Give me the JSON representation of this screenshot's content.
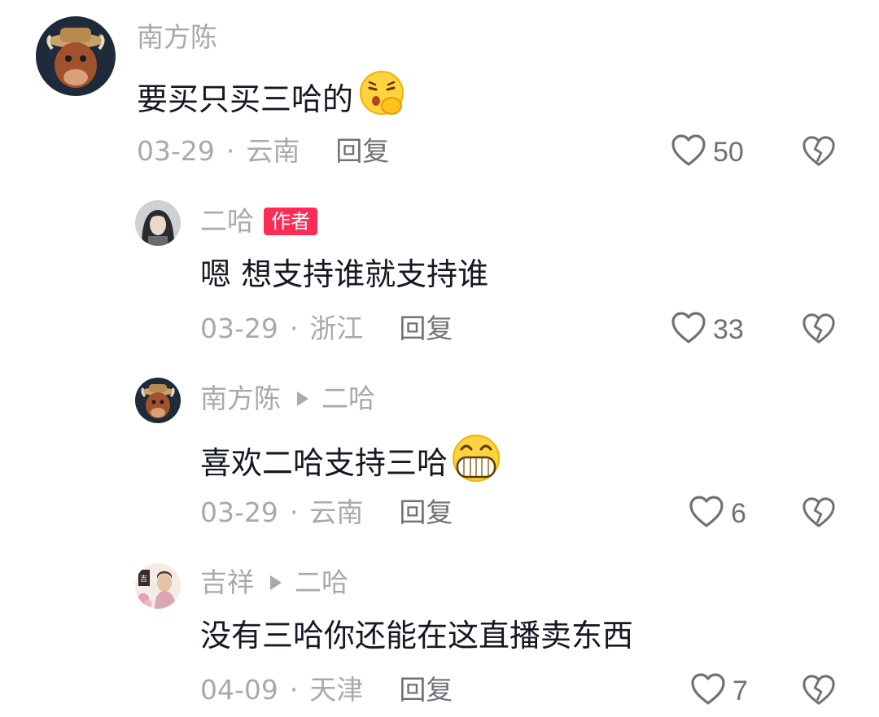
{
  "comments": [
    {
      "username": "南方陈",
      "is_author": false,
      "text": "要买只买三哈的",
      "emoji": "smirk-face-emoji",
      "date": "03-29",
      "location": "云南",
      "reply_label": "回复",
      "likes": "50"
    },
    {
      "username": "二哈",
      "is_author": true,
      "author_badge": "作者",
      "text": "嗯 想支持谁就支持谁",
      "date": "03-29",
      "location": "浙江",
      "reply_label": "回复",
      "likes": "33"
    },
    {
      "username": "南方陈",
      "reply_to": "二哈",
      "text": "喜欢二哈支持三哈",
      "emoji": "grin-face-emoji",
      "date": "03-29",
      "location": "云南",
      "reply_label": "回复",
      "likes": "6"
    },
    {
      "username": "吉祥",
      "reply_to": "二哈",
      "text": "没有三哈你还能在这直播卖东西",
      "date": "04-09",
      "location": "天津",
      "reply_label": "回复",
      "likes": "7"
    }
  ],
  "separator": "·"
}
